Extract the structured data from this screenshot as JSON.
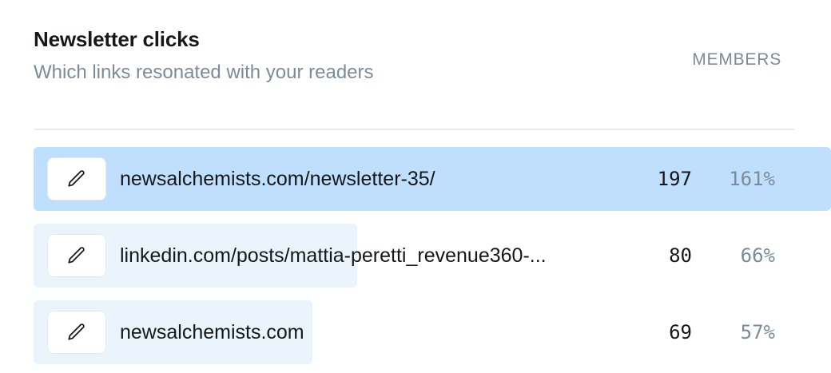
{
  "panel": {
    "title": "Newsletter clicks",
    "subtitle": "Which links resonated with your readers",
    "column_header": "MEMBERS"
  },
  "colors": {
    "bar_active": "#bfdffc",
    "bar_default": "#ebf4fd",
    "muted_text": "#7c8b9a"
  },
  "links": [
    {
      "url": "newsalchemists.com/newsletter-35/",
      "count": "197",
      "percent": "161%",
      "bar_fraction": 1.0,
      "active": true,
      "icon": "pencil-icon"
    },
    {
      "url": "linkedin.com/posts/mattia-peretti_revenue360-...",
      "count": "80",
      "percent": "66%",
      "bar_fraction": 0.406,
      "active": false,
      "icon": "pencil-icon"
    },
    {
      "url": "newsalchemists.com",
      "count": "69",
      "percent": "57%",
      "bar_fraction": 0.35,
      "active": false,
      "icon": "pencil-icon"
    }
  ]
}
